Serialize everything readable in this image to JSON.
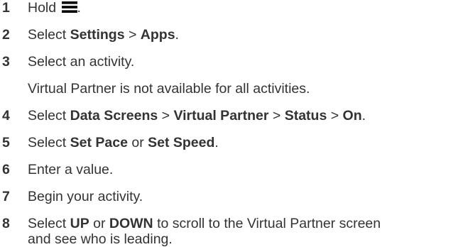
{
  "steps": [
    {
      "number": "1",
      "parts": [
        "Hold ",
        "."
      ],
      "icon": "menu-icon"
    },
    {
      "number": "2",
      "parts": [
        "Select ",
        "Settings",
        " > ",
        "Apps",
        "."
      ]
    },
    {
      "number": "3",
      "text": "Select an activity."
    },
    {
      "note": "Virtual Partner is not available for all activities."
    },
    {
      "number": "4",
      "parts": [
        "Select ",
        "Data Screens",
        " > ",
        "Virtual Partner",
        " > ",
        "Status",
        " > ",
        "On",
        "."
      ]
    },
    {
      "number": "5",
      "parts": [
        "Select ",
        "Set Pace",
        " or ",
        "Set Speed",
        "."
      ]
    },
    {
      "number": "6",
      "text": "Enter a value."
    },
    {
      "number": "7",
      "text": "Begin your activity."
    },
    {
      "number": "8",
      "parts": [
        "Select ",
        "UP",
        " or ",
        "DOWN",
        " to scroll to the Virtual Partner screen",
        "and see who is leading."
      ]
    }
  ]
}
